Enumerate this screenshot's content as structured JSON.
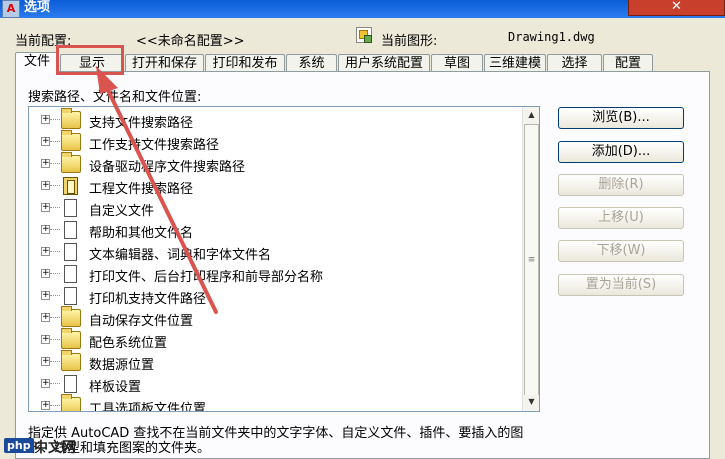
{
  "window": {
    "title": "选项",
    "app_icon": "A"
  },
  "config": {
    "current_profile_label": "当前配置:",
    "current_profile_value": "<<未命名配置>>",
    "current_drawing_label": "当前图形:",
    "current_drawing_value": "Drawing1.dwg"
  },
  "tabs": [
    {
      "label": "文件"
    },
    {
      "label": "显示"
    },
    {
      "label": "打开和保存"
    },
    {
      "label": "打印和发布"
    },
    {
      "label": "系统"
    },
    {
      "label": "用户系统配置"
    },
    {
      "label": "草图"
    },
    {
      "label": "三维建模"
    },
    {
      "label": "选择"
    },
    {
      "label": "配置"
    }
  ],
  "files_tab": {
    "section_label": "搜索路径、文件名和文件位置:",
    "tree_items": [
      {
        "label": "支持文件搜索路径",
        "icon": "folder-icon"
      },
      {
        "label": "工作支持文件搜索路径",
        "icon": "folder-icon"
      },
      {
        "label": "设备驱动程序文件搜索路径",
        "icon": "folder-icon"
      },
      {
        "label": "工程文件搜索路径",
        "icon": "book-icon"
      },
      {
        "label": "自定义文件",
        "icon": "document-icon"
      },
      {
        "label": "帮助和其他文件名",
        "icon": "document-icon"
      },
      {
        "label": "文本编辑器、词典和字体文件名",
        "icon": "document-icon"
      },
      {
        "label": "打印文件、后台打印程序和前导部分名称",
        "icon": "document-icon"
      },
      {
        "label": "打印机支持文件路径",
        "icon": "document-icon"
      },
      {
        "label": "自动保存文件位置",
        "icon": "folder-icon"
      },
      {
        "label": "配色系统位置",
        "icon": "folder-icon"
      },
      {
        "label": "数据源位置",
        "icon": "folder-icon"
      },
      {
        "label": "样板设置",
        "icon": "document-icon"
      },
      {
        "label": "工具选项板文件位置",
        "icon": "folder-icon"
      }
    ],
    "buttons": {
      "browse": "浏览(B)...",
      "add": "添加(D)...",
      "remove": "删除(R)",
      "move_up": "上移(U)",
      "move_down": "下移(W)",
      "set_current": "置为当前(S)"
    },
    "description": "指定供 AutoCAD 查找不在当前文件夹中的文字字体、自定义文件、插件、要插入的图形、线型和填充图案的文件夹。"
  },
  "watermark": {
    "brand": "php",
    "text": "中文网"
  }
}
